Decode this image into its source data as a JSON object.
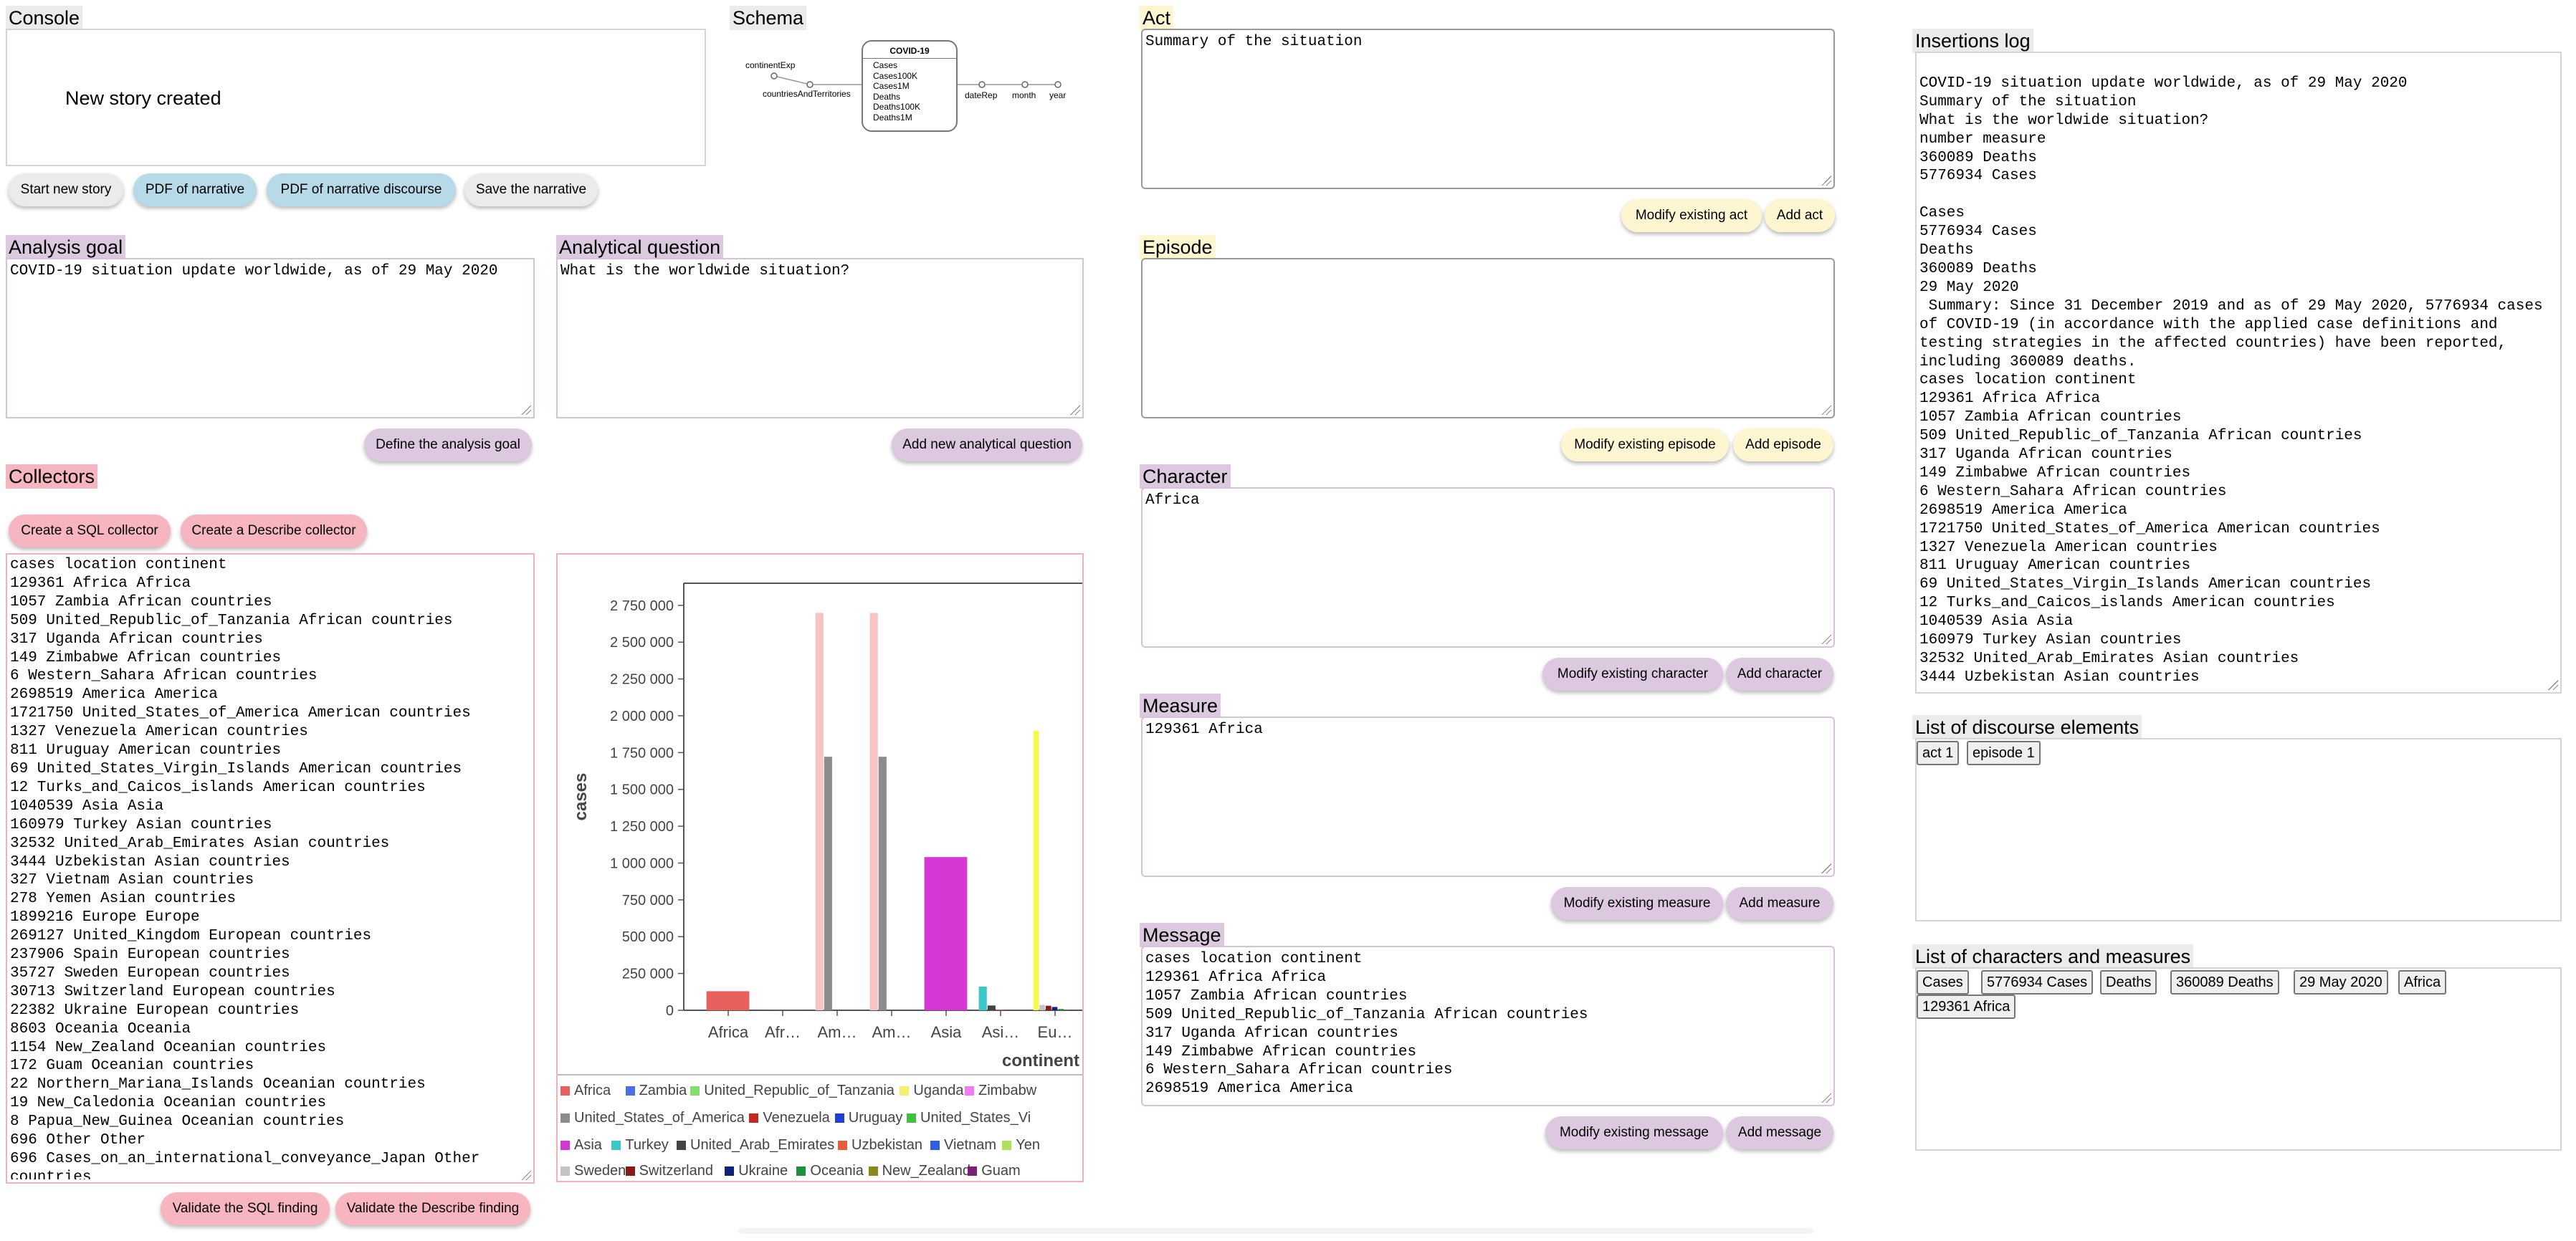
{
  "console": {
    "title": "Console",
    "message": "New story created"
  },
  "schema": {
    "title": "Schema",
    "cube_name": "COVID-19",
    "measures": [
      "Cases",
      "Cases100K",
      "Cases1M",
      "Deaths",
      "Deaths100K",
      "Deaths1M"
    ],
    "left_nodes": [
      "continentExp",
      "countriesAndTerritories"
    ],
    "right_nodes": [
      "dateRep",
      "month",
      "year"
    ]
  },
  "toolbar": {
    "start_new_story": "Start new story",
    "pdf_narrative": "PDF of narrative",
    "pdf_discourse": "PDF of narrative discourse",
    "save_narrative": "Save the narrative"
  },
  "analysis_goal": {
    "title": "Analysis goal",
    "value": "COVID-19 situation update worldwide, as of 29 May 2020",
    "button": "Define the analysis goal"
  },
  "analytical_question": {
    "title": "Analytical question",
    "value": "What is the worldwide situation?",
    "button": "Add new analytical question"
  },
  "collectors": {
    "title": "Collectors",
    "create_sql": "Create a SQL collector",
    "create_describe": "Create a Describe collector",
    "validate_sql": "Validate the SQL finding",
    "validate_describe": "Validate the Describe finding",
    "result_lines": [
      "cases location continent",
      "129361 Africa Africa",
      "1057 Zambia African countries",
      "509 United_Republic_of_Tanzania African countries",
      "317 Uganda African countries",
      "149 Zimbabwe African countries",
      "6 Western_Sahara African countries",
      "2698519 America America",
      "1721750 United_States_of_America American countries",
      "1327 Venezuela American countries",
      "811 Uruguay American countries",
      "69 United_States_Virgin_Islands American countries",
      "12 Turks_and_Caicos_islands American countries",
      "1040539 Asia Asia",
      "160979 Turkey Asian countries",
      "32532 United_Arab_Emirates Asian countries",
      "3444 Uzbekistan Asian countries",
      "327 Vietnam Asian countries",
      "278 Yemen Asian countries",
      "1899216 Europe Europe",
      "269127 United_Kingdom European countries",
      "237906 Spain European countries",
      "35727 Sweden European countries",
      "30713 Switzerland European countries",
      "22382 Ukraine European countries",
      "8603 Oceania Oceania",
      "1154 New_Zealand Oceanian countries",
      "172 Guam Oceanian countries",
      "22 Northern_Mariana_Islands Oceanian countries",
      "19 New_Caledonia Oceanian countries",
      "8 Papua_New_Guinea Oceanian countries",
      "696 Other Other",
      "696 Cases_on_an_international_conveyance_Japan Other",
      "countries"
    ]
  },
  "chart_data": {
    "type": "bar",
    "xlabel": "continent",
    "ylabel": "cases",
    "ylim": [
      0,
      2900000
    ],
    "ytick_values": [
      0,
      250000,
      500000,
      750000,
      1000000,
      1250000,
      1500000,
      1750000,
      2000000,
      2250000,
      2500000,
      2750000
    ],
    "ytick_labels": [
      "0",
      "250 000",
      "500 000",
      "750 000",
      "1 000 000",
      "1 250 000",
      "1 500 000",
      "1 750 000",
      "2 000 000",
      "2 250 000",
      "2 500 000",
      "2 750 000"
    ],
    "categories": [
      "Africa",
      "Afr…",
      "Am…",
      "Am…",
      "Asia",
      "Asi…",
      "Eu…"
    ],
    "series": [
      {
        "name": "Africa",
        "category": "Africa",
        "value": 129361,
        "color": "#e8605c"
      },
      {
        "name": "Zambia",
        "category": "Afr…",
        "value": 1057,
        "color": "#4c6ee6"
      },
      {
        "name": "United_Republic_of_Tanzania",
        "category": "Afr…",
        "value": 509,
        "color": "#7fe06f"
      },
      {
        "name": "Uganda",
        "category": "Afr…",
        "value": 317,
        "color": "#f4f06a"
      },
      {
        "name": "Zimbabwe",
        "category": "Afr…",
        "value": 149,
        "color": "#f07ef0"
      },
      {
        "name": "America",
        "category": "Am…",
        "value": 2698519,
        "color": "#f7c3c3"
      },
      {
        "name": "United_States_of_America",
        "category": "Am…",
        "value": 1721750,
        "color": "#8c8c8c"
      },
      {
        "name": "Venezuela",
        "category": "Am…",
        "value": 1327,
        "color": "#c4281e"
      },
      {
        "name": "Uruguay",
        "category": "Am…",
        "value": 811,
        "color": "#1f3fd6"
      },
      {
        "name": "United_States_Vi",
        "category": "Am…",
        "value": 69,
        "color": "#3fc03f"
      },
      {
        "name": "Asia",
        "category": "Asia",
        "value": 1040539,
        "color": "#d437d4"
      },
      {
        "name": "Turkey",
        "category": "Asi…",
        "value": 160979,
        "color": "#3cc8c8"
      },
      {
        "name": "United_Arab_Emirates",
        "category": "Asi…",
        "value": 32532,
        "color": "#444444"
      },
      {
        "name": "Uzbekistan",
        "category": "Asi…",
        "value": 3444,
        "color": "#e85c3c"
      },
      {
        "name": "Vietnam",
        "category": "Asi…",
        "value": 327,
        "color": "#2f5fe0"
      },
      {
        "name": "Yen",
        "category": "Asi…",
        "value": 278,
        "color": "#aee05a"
      },
      {
        "name": "Europe",
        "category": "Eu…",
        "value": 1899216,
        "color": "#f8f84a"
      },
      {
        "name": "Sweden",
        "category": "Eu…",
        "value": 35727,
        "color": "#c4c4c4"
      },
      {
        "name": "Switzerland",
        "category": "Eu…",
        "value": 30713,
        "color": "#8a1a1a"
      },
      {
        "name": "Ukraine",
        "category": "Eu…",
        "value": 22382,
        "color": "#10237a"
      },
      {
        "name": "Oceania",
        "category": "Eu…",
        "value": 8603,
        "color": "#1f8f3f"
      },
      {
        "name": "New_Zealand",
        "category": "Eu…",
        "value": 1154,
        "color": "#8a8a1a"
      },
      {
        "name": "Guam",
        "category": "Eu…",
        "value": 172,
        "color": "#7a1f7a"
      }
    ],
    "legend_rows": [
      [
        "Africa",
        "Zambia",
        "United_Republic_of_Tanzania",
        "Uganda",
        "Zimbabw"
      ],
      [
        "United_States_of_America",
        "Venezuela",
        "Uruguay",
        "United_States_Vi"
      ],
      [
        "Asia",
        "Turkey",
        "United_Arab_Emirates",
        "Uzbekistan",
        "Vietnam",
        "Yen"
      ],
      [
        "Sweden",
        "Switzerland",
        "Ukraine",
        "Oceania",
        "New_Zealand",
        "Guam"
      ]
    ],
    "legend_colors": [
      [
        "#e8605c",
        "#4c6ee6",
        "#7fe06f",
        "#f4f06a",
        "#f07ef0"
      ],
      [
        "#8c8c8c",
        "#c4281e",
        "#1f3fd6",
        "#3fc03f"
      ],
      [
        "#d437d4",
        "#3cc8c8",
        "#444444",
        "#e85c3c",
        "#2f5fe0",
        "#aee05a"
      ],
      [
        "#c4c4c4",
        "#8a1a1a",
        "#10237a",
        "#1f8f3f",
        "#8a8a1a",
        "#7a1f7a"
      ]
    ]
  },
  "act": {
    "title": "Act",
    "value": "Summary of the situation",
    "modify": "Modify existing act",
    "add": "Add act"
  },
  "episode": {
    "title": "Episode",
    "value": "",
    "modify": "Modify existing episode",
    "add": "Add episode"
  },
  "character": {
    "title": "Character",
    "value": "Africa",
    "modify": "Modify existing character",
    "add": "Add character"
  },
  "measure": {
    "title": "Measure",
    "value": "129361 Africa",
    "modify": "Modify existing measure",
    "add": "Add measure"
  },
  "message": {
    "title": "Message",
    "lines": [
      "cases location continent",
      "129361 Africa Africa",
      "1057 Zambia African countries",
      "509 United_Republic_of_Tanzania African countries",
      "317 Uganda African countries",
      "149 Zimbabwe African countries",
      "6 Western_Sahara African countries",
      "2698519 America America"
    ],
    "modify": "Modify existing message",
    "add": "Add message"
  },
  "insertions_log": {
    "title": "Insertions log",
    "text": "\nCOVID-19 situation update worldwide, as of 29 May 2020\nSummary of the situation\nWhat is the worldwide situation?\nnumber measure\n360089 Deaths\n5776934 Cases\n\nCases\n5776934 Cases\nDeaths\n360089 Deaths\n29 May 2020\n Summary: Since 31 December 2019 and as of 29 May 2020, 5776934 cases of COVID-19 (in accordance with the applied case definitions and testing strategies in the affected countries) have been reported, including 360089 deaths.\ncases location continent\n129361 Africa Africa\n1057 Zambia African countries\n509 United_Republic_of_Tanzania African countries\n317 Uganda African countries\n149 Zimbabwe African countries\n6 Western_Sahara African countries\n2698519 America America\n1721750 United_States_of_America American countries\n1327 Venezuela American countries\n811 Uruguay American countries\n69 United_States_Virgin_Islands American countries\n12 Turks_and_Caicos_islands American countries\n1040539 Asia Asia\n160979 Turkey Asian countries\n32532 United_Arab_Emirates Asian countries\n3444 Uzbekistan Asian countries"
  },
  "discourse_elements": {
    "title": "List of discourse elements",
    "items": [
      "act 1",
      "episode 1"
    ]
  },
  "characters_measures": {
    "title": "List of characters and measures",
    "items": [
      "Cases",
      "5776934 Cases",
      "Deaths",
      "360089 Deaths",
      "29 May 2020",
      "Africa",
      "129361 Africa"
    ]
  }
}
